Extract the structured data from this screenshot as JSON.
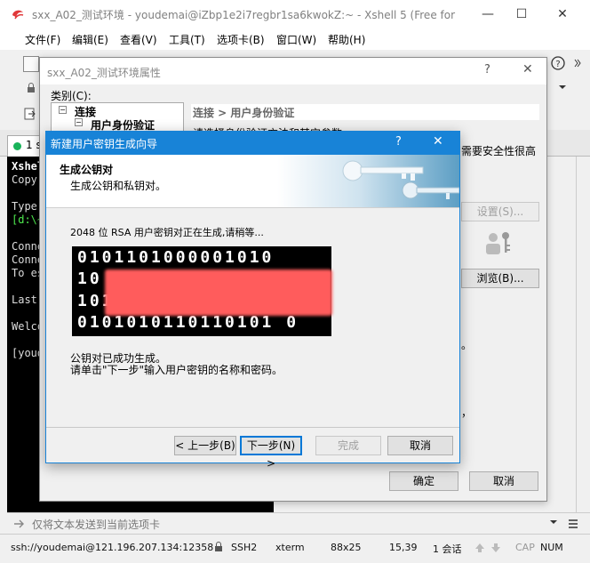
{
  "main_window": {
    "title": "sxx_A02_测试环境 - youdemai@iZbp1e2i7regbr1sa6kwokZ:~ - Xshell 5 (Free for",
    "controls": {
      "minimize": "—",
      "maximize": "☐",
      "close": "✕"
    }
  },
  "menu": {
    "items": [
      "文件(F)",
      "编辑(E)",
      "查看(V)",
      "工具(T)",
      "选项卡(B)",
      "窗口(W)",
      "帮助(H)"
    ]
  },
  "terminal": {
    "tab_label": "1 s",
    "lines": [
      "Xshel",
      "Copyr",
      "",
      "Type",
      "[d:\\~",
      "",
      "Conne",
      "Conne",
      "To es",
      "",
      "Last",
      "",
      "Welco",
      "",
      "[youd"
    ]
  },
  "properties_dialog": {
    "title": "sxx_A02_测试环境属性",
    "help": "?",
    "close": "✕",
    "category_label": "类别(C):",
    "tree": {
      "root": "连接",
      "child": "用户身份验证"
    },
    "section_title": "连接 > 用户身份验证",
    "desc_line": "请选择身份验证方法和其它参数",
    "security_note": "需要安全性很高",
    "settings_button": "设置(S)...",
    "browse_button": "浏览(B)...",
    "ok_button": "确定",
    "cancel_button": "取消",
    "side_fragment_1": "。",
    "side_fragment_2": "，"
  },
  "wizard": {
    "title": "新建用户密钥生成向导",
    "help": "?",
    "close": "✕",
    "header_title": "生成公钥对",
    "header_subtitle": "生成公钥和私钥对。",
    "progress_text": "2048 位 RSA 用户密钥对正在生成,请稍等...",
    "bits": [
      "0101101000001010",
      "10",
      "1010",
      "0101010110110101 0"
    ],
    "result_line1": "公钥对已成功生成。",
    "result_line2": "请单击\"下一步\"输入用户密钥的名称和密码。",
    "back_button": "< 上一步(B)",
    "next_button": "下一步(N) >",
    "finish_button": "完成",
    "cancel_button": "取消"
  },
  "send_bar": {
    "text": "仅将文本发送到当前选项卡"
  },
  "status": {
    "connection": "ssh://youdemai@121.196.207.134:12358",
    "protocol": "SSH2",
    "terminal": "xterm",
    "size": "88x25",
    "cursor": "15,39",
    "sessions": "1 会话",
    "caps": "CAP",
    "num": "NUM"
  },
  "colors": {
    "wizard_accent": "#1883d7",
    "redaction": "#ff5c5c",
    "tab_status": "#19b35a"
  }
}
